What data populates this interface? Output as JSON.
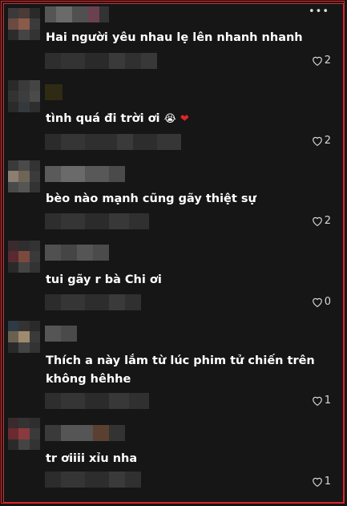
{
  "header": {
    "more_label": "•••"
  },
  "comments": [
    {
      "text": "Hai người yêu nhau lẹ lên nhanh nhanh",
      "likes": "2"
    },
    {
      "text": "tình quá đi trời ơi",
      "emoji1": "😭",
      "emoji2": "❤",
      "likes": "2"
    },
    {
      "text": "bèo nào mạnh cũng gãy thiệt sự",
      "likes": "2"
    },
    {
      "text": "tui gãy r bà Chi ơi",
      "likes": "0"
    },
    {
      "text": "Thích a này lắm từ lúc phim tử chiến trên không hêhhe",
      "likes": "1"
    },
    {
      "text": "tr ơiiii xỉu nha",
      "likes": "1"
    }
  ],
  "colors": {
    "accent": "#e0242b",
    "background": "#161616"
  },
  "icons": {
    "like": "heart-outline-icon",
    "more": "more-dots-icon"
  }
}
